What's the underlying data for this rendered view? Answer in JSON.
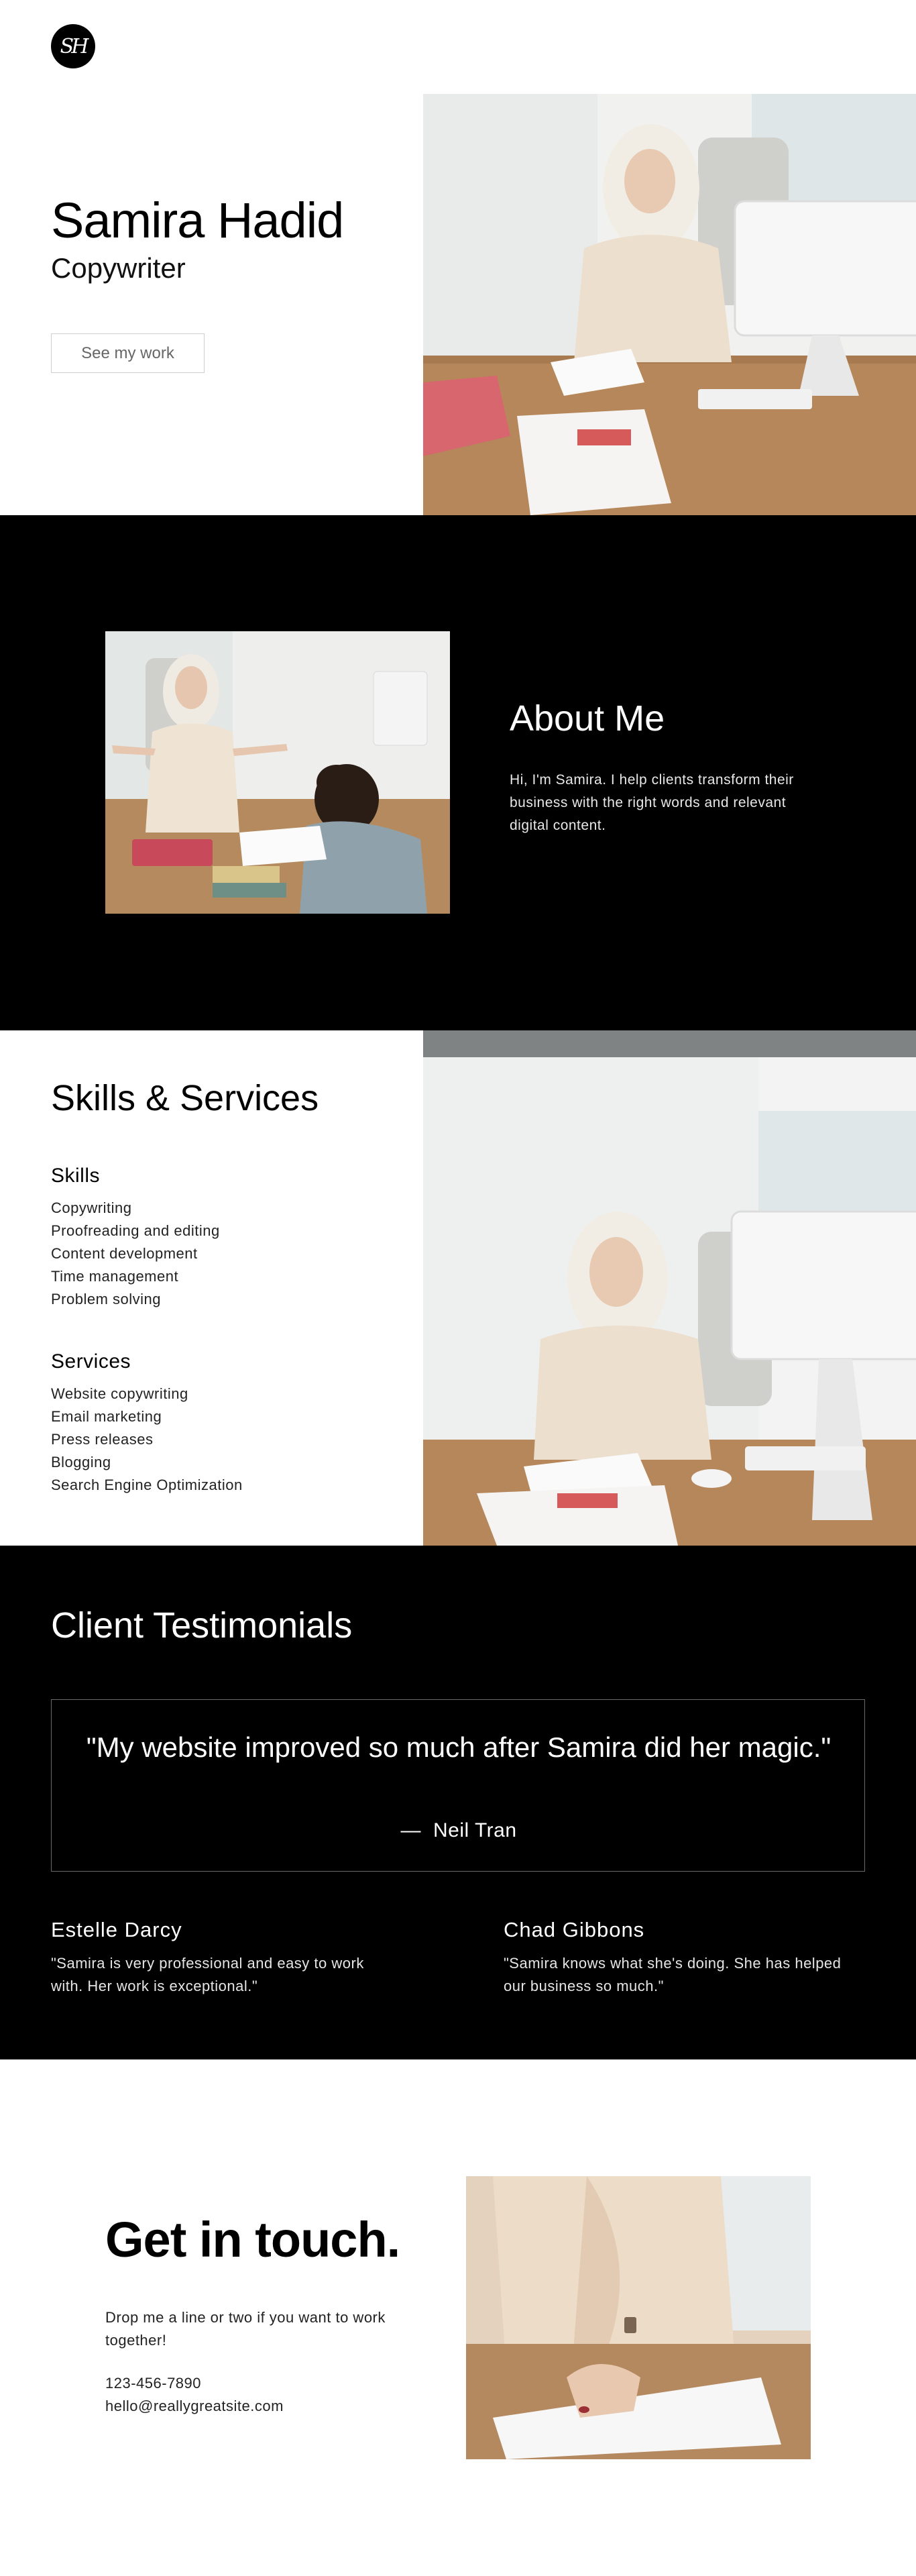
{
  "header": {
    "logo_text": "SH"
  },
  "hero": {
    "name": "Samira Hadid",
    "role": "Copywriter",
    "button_label": "See my work",
    "photo_icon": "woman-at-desk-photo"
  },
  "about": {
    "title": "About Me",
    "text": "Hi, I'm Samira. I help clients transform their business with the right words and relevant digital content.",
    "photo_icon": "mentoring-photo"
  },
  "skills": {
    "title": "Skills & Services",
    "skills_heading": "Skills",
    "skills_items": [
      "Copywriting",
      "Proofreading and editing",
      "Content development",
      "Time management",
      "Problem solving"
    ],
    "services_heading": "Services",
    "services_items": [
      "Website copywriting",
      "Email marketing",
      "Press releases",
      "Blogging",
      "Search Engine Optimization"
    ],
    "photo_icon": "portrait-at-desk-photo"
  },
  "testimonials": {
    "title": "Client Testimonials",
    "featured_quote": "\"My website improved so much after Samira did her magic.\"",
    "featured_dash": "—",
    "featured_author": "Neil Tran",
    "items": [
      {
        "name": "Estelle Darcy",
        "text": "\"Samira is very professional and easy to work with. Her work is exceptional.\""
      },
      {
        "name": "Chad Gibbons",
        "text": "\"Samira knows what she's doing. She has helped our business so much.\""
      }
    ]
  },
  "contact": {
    "title": "Get in touch.",
    "text": "Drop me a line or two if you want to work together!",
    "phone": "123-456-7890",
    "email": "hello@reallygreatsite.com",
    "photo_icon": "writing-in-notebook-photo"
  },
  "colors": {
    "black": "#000000",
    "white": "#ffffff",
    "accent_beige": "#e9dccb"
  }
}
